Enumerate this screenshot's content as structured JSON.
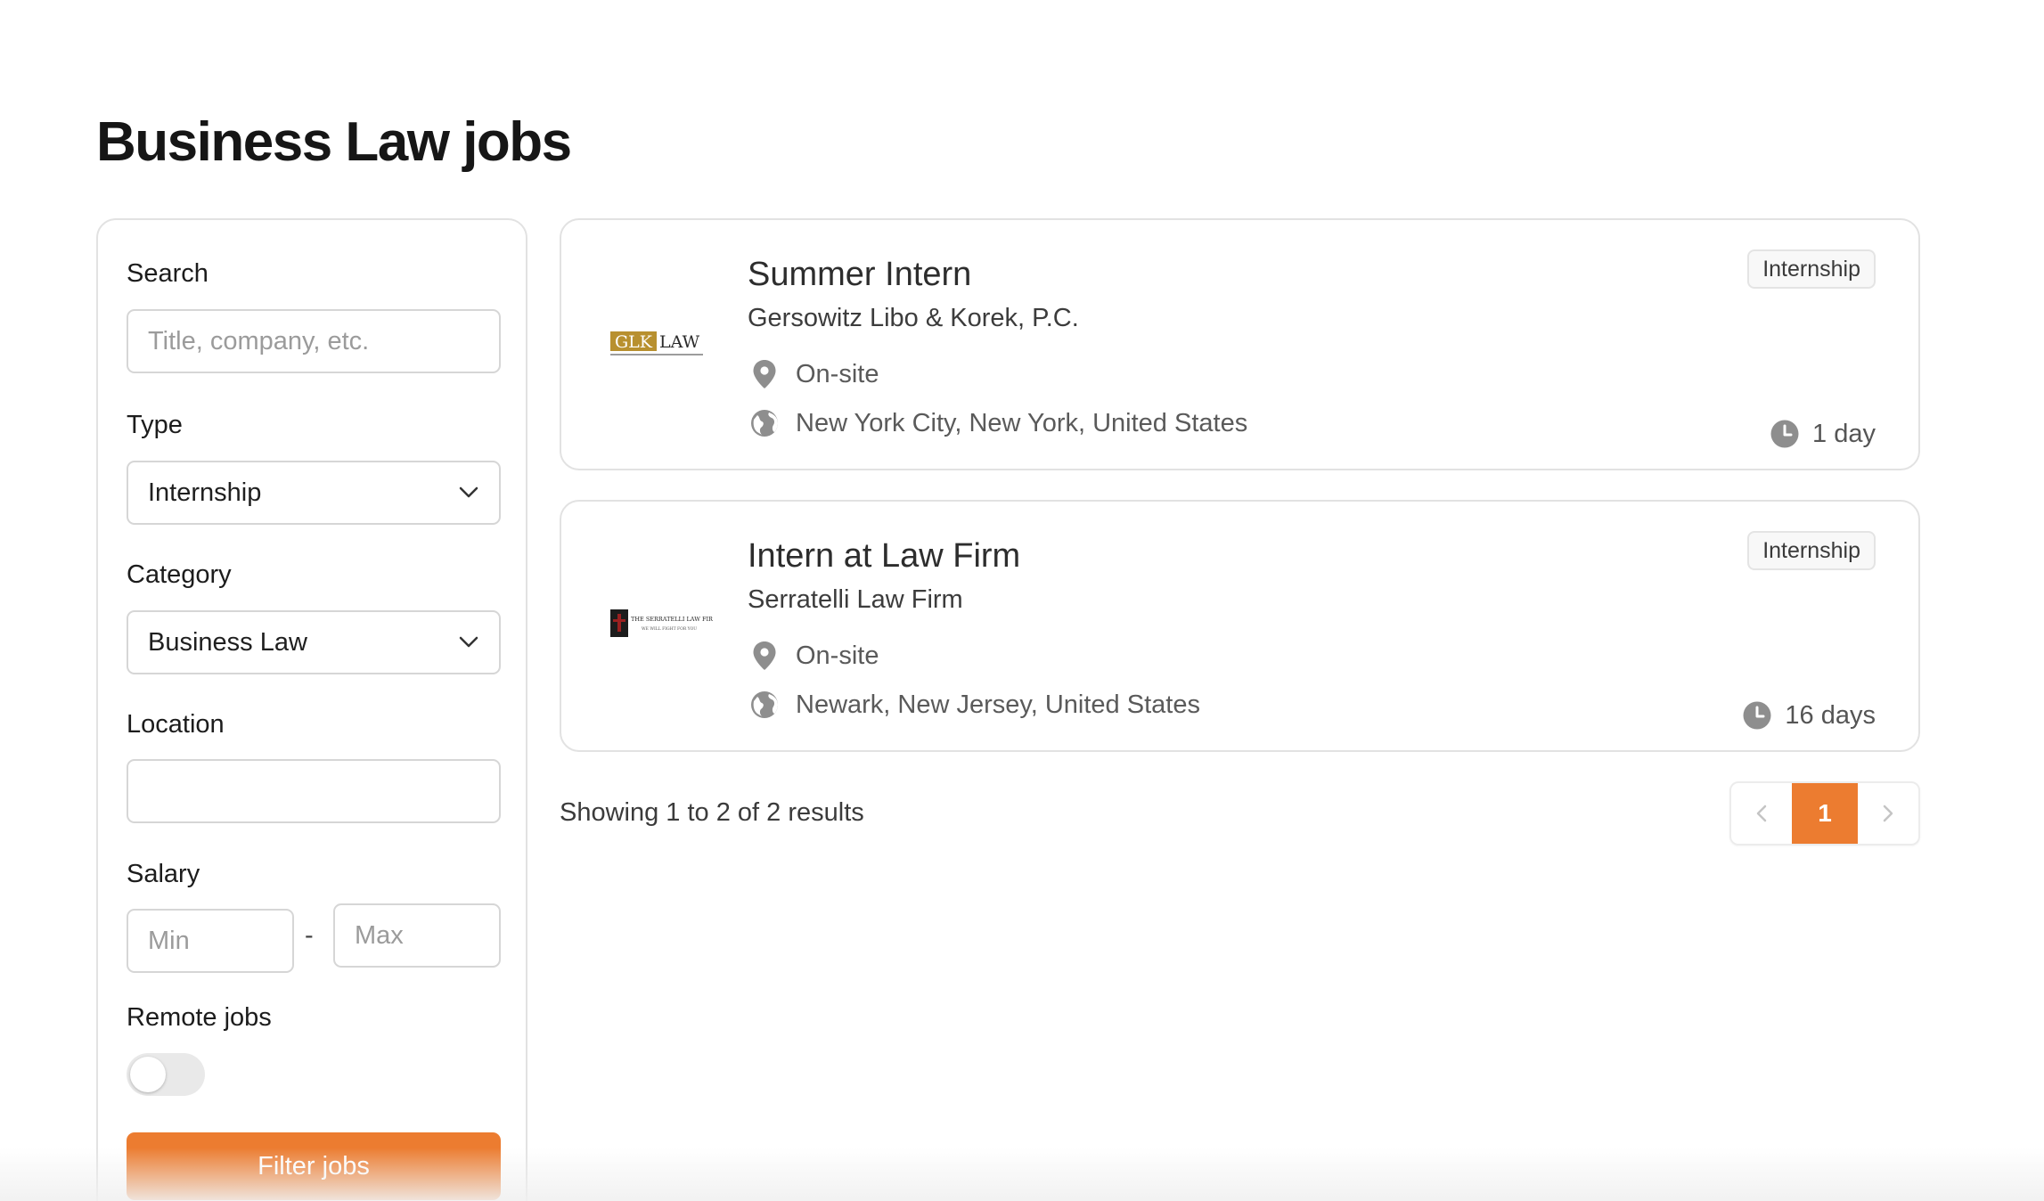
{
  "page": {
    "title": "Business Law jobs"
  },
  "filters": {
    "search": {
      "label": "Search",
      "placeholder": "Title, company, etc.",
      "value": ""
    },
    "type": {
      "label": "Type",
      "value": "Internship"
    },
    "category": {
      "label": "Category",
      "value": "Business Law"
    },
    "location": {
      "label": "Location",
      "value": ""
    },
    "salary": {
      "label": "Salary",
      "min_placeholder": "Min",
      "max_placeholder": "Max",
      "separator": "-"
    },
    "remote": {
      "label": "Remote jobs",
      "enabled": false
    },
    "submit_label": "Filter jobs"
  },
  "jobs": [
    {
      "title": "Summer Intern",
      "company": "Gersowitz Libo & Korek, P.C.",
      "logo_text": "GLK LAW",
      "workplace": "On-site",
      "location": "New York City, New York, United States",
      "type": "Internship",
      "posted": "1 day"
    },
    {
      "title": "Intern at Law Firm",
      "company": "Serratelli Law Firm",
      "logo_text": "THE SERRATELLI LAW FIRM",
      "workplace": "On-site",
      "location": "Newark, New Jersey, United States",
      "type": "Internship",
      "posted": "16 days"
    }
  ],
  "results": {
    "summary": "Showing 1 to 2 of 2 results"
  },
  "pagination": {
    "current_page": "1"
  },
  "colors": {
    "accent": "#ec7c30",
    "border": "#e2e2e2",
    "icon_gray": "#8e8e8e"
  },
  "icons": {
    "workplace": "map-pin-icon",
    "location": "globe-icon",
    "posted": "clock-icon",
    "select": "chevron-down-icon"
  }
}
